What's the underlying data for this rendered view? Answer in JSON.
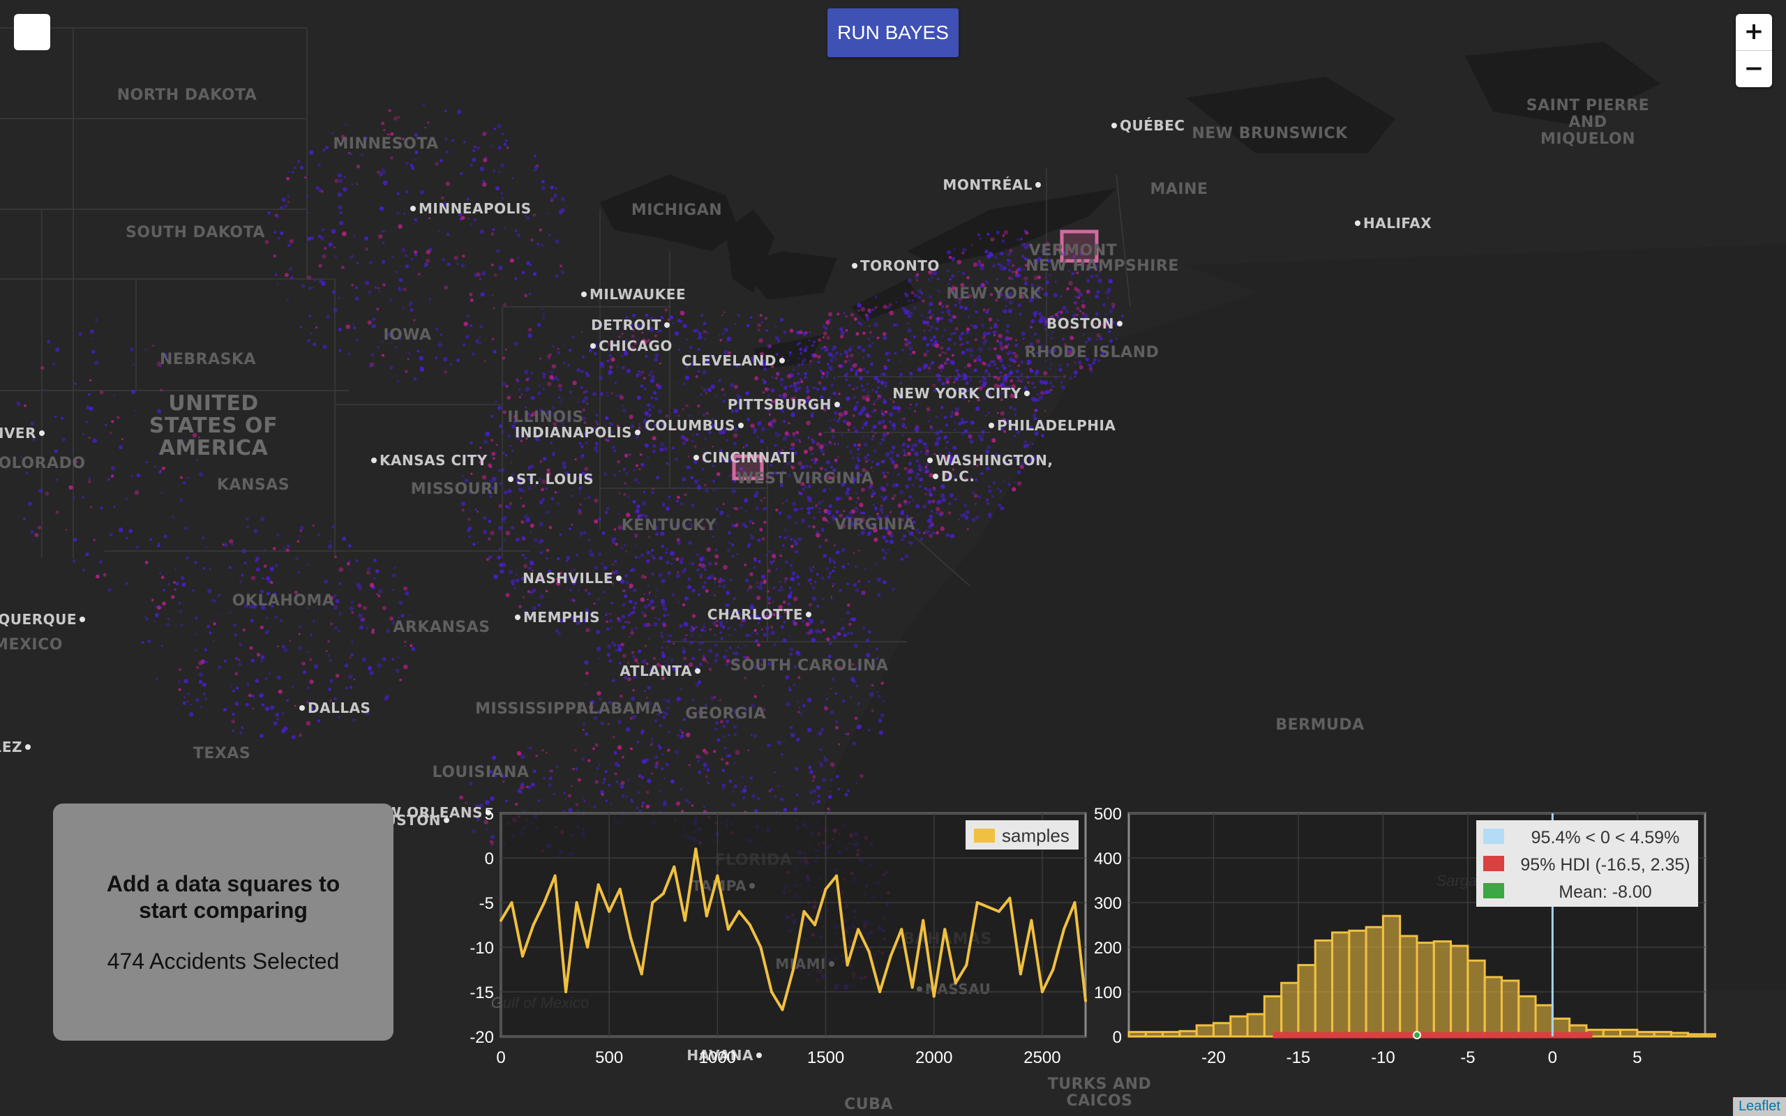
{
  "controls": {
    "run_button": "RUN BAYES",
    "zoom_in": "+",
    "zoom_out": "−"
  },
  "info_panel": {
    "title": "Add a data squares to start comparing",
    "count_text": "474 Accidents Selected"
  },
  "attribution": "Leaflet",
  "map": {
    "cities": [
      {
        "name": "MINNEAPOLIS"
      },
      {
        "name": "MILWAUKEE"
      },
      {
        "name": "CHICAGO"
      },
      {
        "name": "DETROIT"
      },
      {
        "name": "TORONTO"
      },
      {
        "name": "MONTRÉAL"
      },
      {
        "name": "QUÉBEC"
      },
      {
        "name": "HALIFAX"
      },
      {
        "name": "BOSTON"
      },
      {
        "name": "CLEVELAND"
      },
      {
        "name": "PITTSBURGH"
      },
      {
        "name": "NEW YORK CITY"
      },
      {
        "name": "PHILADELPHIA"
      },
      {
        "name": "COLUMBUS"
      },
      {
        "name": "INDIANAPOLIS"
      },
      {
        "name": "CINCINNATI"
      },
      {
        "name": "WASHINGTON,"
      },
      {
        "name": "D.C."
      },
      {
        "name": "KANSAS CITY"
      },
      {
        "name": "ST. LOUIS"
      },
      {
        "name": "NASHVILLE"
      },
      {
        "name": "MEMPHIS"
      },
      {
        "name": "CHARLOTTE"
      },
      {
        "name": "ATLANTA"
      },
      {
        "name": "DALLAS"
      },
      {
        "name": "HOUSTON"
      },
      {
        "name": "NEW ORLEANS"
      },
      {
        "name": "TAMPA"
      },
      {
        "name": "MIAMI"
      },
      {
        "name": "NASSAU"
      },
      {
        "name": "HAVANA"
      },
      {
        "name": "ALBUQUERQUE"
      },
      {
        "name": "NVER"
      },
      {
        "name": "JUAREZ"
      }
    ],
    "regions": [
      "NORTH DAKOTA",
      "MINNESOTA",
      "SOUTH DAKOTA",
      "NEBRASKA",
      "IOWA",
      "KANSAS",
      "MISSOURI",
      "ILLINOIS",
      "KENTUCKY",
      "WEST VIRGINIA",
      "VIRGINIA",
      "OKLAHOMA",
      "ARKANSAS",
      "MISSISSIPPI",
      "ALABAMA",
      "GEORGIA",
      "SOUTH CAROLINA",
      "LOUISIANA",
      "TEXAS",
      "FLORIDA",
      "MICHIGAN",
      "NEW YORK",
      "VERMONT",
      "NEW HAMPSHIRE",
      "MAINE",
      "RHODE ISLAND",
      "NEW BRUNSWICK",
      "OLORADO",
      "MEXICO",
      "CUBA",
      "BAHAMAS",
      "TURKS AND",
      "CAICOS",
      "BERMUDA"
    ],
    "country_lines": [
      "UNITED",
      "STATES OF",
      "AMERICA"
    ],
    "miquelon_lines": [
      "SAINT PIERRE",
      "AND",
      "MIQUELON"
    ],
    "waters": [
      "Gulf of Mexico",
      "Sargasso"
    ]
  },
  "chart_data": [
    {
      "type": "line",
      "series": [
        {
          "name": "samples",
          "color": "#f0c040",
          "x": [
            0,
            50,
            100,
            150,
            200,
            250,
            300,
            350,
            400,
            450,
            500,
            550,
            600,
            650,
            700,
            750,
            800,
            850,
            900,
            950,
            1000,
            1050,
            1100,
            1150,
            1200,
            1250,
            1300,
            1350,
            1400,
            1450,
            1500,
            1550,
            1600,
            1650,
            1700,
            1750,
            1800,
            1850,
            1900,
            1950,
            2000,
            2050,
            2100,
            2150,
            2200,
            2250,
            2300,
            2350,
            2400,
            2450,
            2500,
            2550,
            2600,
            2650,
            2700
          ],
          "values": [
            -7,
            -5,
            -11,
            -7.5,
            -5,
            -2,
            -15,
            -5,
            -10,
            -3,
            -6,
            -3.5,
            -9,
            -13,
            -5,
            -4,
            -1,
            -7,
            1,
            -6.5,
            -2,
            -8,
            -6,
            -7.5,
            -10,
            -15,
            -17,
            -12.5,
            -6,
            -7.5,
            -3.5,
            -2,
            -12,
            -8,
            -10.5,
            -15,
            -11,
            -8,
            -14.5,
            -7,
            -15.5,
            -8,
            -14,
            -12,
            -5,
            -5.5,
            -6,
            -4.5,
            -13,
            -7,
            -15,
            -12.5,
            -8,
            -5,
            -16
          ]
        }
      ],
      "xlim": [
        0,
        2700
      ],
      "ylim": [
        -20,
        5
      ],
      "xticks": [
        "0",
        "500",
        "1000",
        "1500",
        "2000",
        "2500"
      ],
      "yticks": [
        "5",
        "0",
        "-5",
        "-10",
        "-15",
        "-20"
      ],
      "legend": "top-right",
      "grid": true
    },
    {
      "type": "bar",
      "title": "",
      "bin_width": 1,
      "bin_starts": [
        -25,
        -24,
        -23,
        -22,
        -21,
        -20,
        -19,
        -18,
        -17,
        -16,
        -15,
        -14,
        -13,
        -12,
        -11,
        -10,
        -9,
        -8,
        -7,
        -6,
        -5,
        -4,
        -3,
        -2,
        -1,
        0,
        1,
        2,
        3,
        4,
        5,
        6,
        7,
        8,
        9
      ],
      "values": [
        10,
        10,
        10,
        12,
        25,
        30,
        45,
        50,
        90,
        120,
        160,
        215,
        233,
        237,
        245,
        270,
        225,
        210,
        213,
        203,
        170,
        133,
        125,
        90,
        70,
        40,
        25,
        15,
        15,
        15,
        10,
        10,
        8,
        5,
        5
      ],
      "xlim": [
        -25,
        9
      ],
      "ylim": [
        0,
        500
      ],
      "xticks": [
        "-20",
        "-15",
        "-10",
        "-5",
        "0",
        "5"
      ],
      "yticks": [
        "500",
        "400",
        "300",
        "200",
        "100",
        "0"
      ],
      "hdi": [
        -16.5,
        2.35
      ],
      "mean": -8.0,
      "zero_line": 0,
      "colors": {
        "bars": "#f0c040",
        "hdi": "#d94040",
        "mean": "#3aa843",
        "zero": "#a8d4f0"
      },
      "legend": "top-right",
      "legend_entries": [
        {
          "label": "95.4% < 0 < 4.59%",
          "color": "#b3dcf7"
        },
        {
          "label": "95% HDI (-16.5, 2.35)",
          "color": "#d94040"
        },
        {
          "label": "Mean: -8.00",
          "color": "#3aa843"
        }
      ]
    }
  ]
}
